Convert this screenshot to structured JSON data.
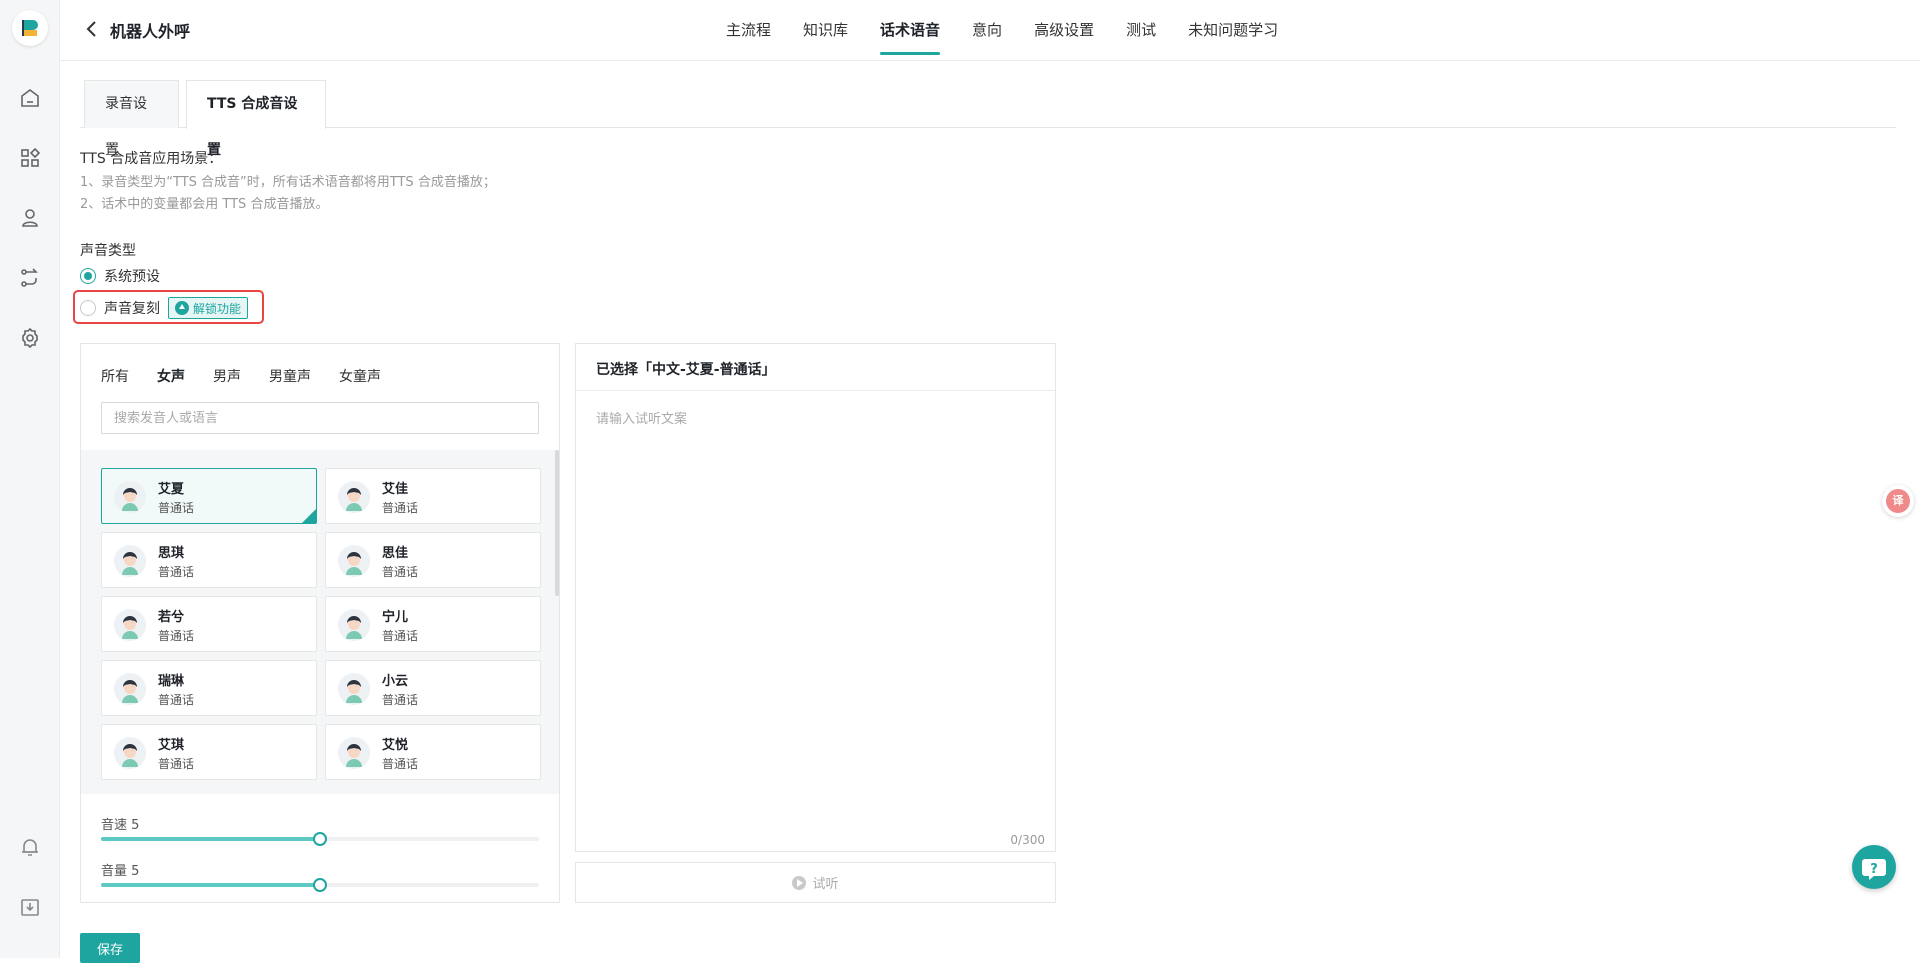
{
  "header": {
    "title": "机器人外呼",
    "tabs": [
      {
        "label": "主流程"
      },
      {
        "label": "知识库"
      },
      {
        "label": "话术语音",
        "active": true
      },
      {
        "label": "意向"
      },
      {
        "label": "高级设置"
      },
      {
        "label": "测试"
      },
      {
        "label": "未知问题学习"
      }
    ]
  },
  "sidebar": {
    "icons": [
      "home-icon",
      "apps-icon",
      "user-icon",
      "flow-icon",
      "gear-icon",
      "bell-icon",
      "download-icon"
    ]
  },
  "subtabs": [
    {
      "label": "录音设置"
    },
    {
      "label": "TTS 合成音设置",
      "active": true
    }
  ],
  "description": {
    "heading": "TTS 合成音应用场景：",
    "line1": "1、录音类型为“TTS 合成音”时，所有话术语音都将用TTS 合成音播放；",
    "line2": "2、话术中的变量都会用 TTS 合成音播放。"
  },
  "voice_type": {
    "label": "声音类型",
    "option_preset": "系统预设",
    "option_clone": "声音复刻",
    "unlock_label": "解锁功能",
    "selected": "系统预设"
  },
  "voice_panel": {
    "filters": [
      {
        "label": "所有"
      },
      {
        "label": "女声",
        "active": true
      },
      {
        "label": "男声"
      },
      {
        "label": "男童声"
      },
      {
        "label": "女童声"
      }
    ],
    "search_placeholder": "搜索发音人或语言",
    "voices": [
      {
        "name": "艾夏",
        "lang": "普通话",
        "selected": true
      },
      {
        "name": "艾佳",
        "lang": "普通话"
      },
      {
        "name": "思琪",
        "lang": "普通话"
      },
      {
        "name": "思佳",
        "lang": "普通话"
      },
      {
        "name": "若兮",
        "lang": "普通话"
      },
      {
        "name": "宁儿",
        "lang": "普通话"
      },
      {
        "name": "瑞琳",
        "lang": "普通话"
      },
      {
        "name": "小云",
        "lang": "普通话"
      },
      {
        "name": "艾琪",
        "lang": "普通话"
      },
      {
        "name": "艾悦",
        "lang": "普通话"
      }
    ],
    "speed_label": "音速 5",
    "speed_value": 5,
    "volume_label": "音量 5",
    "volume_value": 5,
    "slider_max": 10
  },
  "preview_panel": {
    "title": "已选择「中文-艾夏-普通话」",
    "text_placeholder": "请输入试听文案",
    "char_count": "0/300",
    "listen_label": "试听"
  },
  "save_label": "保存",
  "colors": {
    "accent": "#1ea5a0",
    "highlight": "#e84545"
  }
}
